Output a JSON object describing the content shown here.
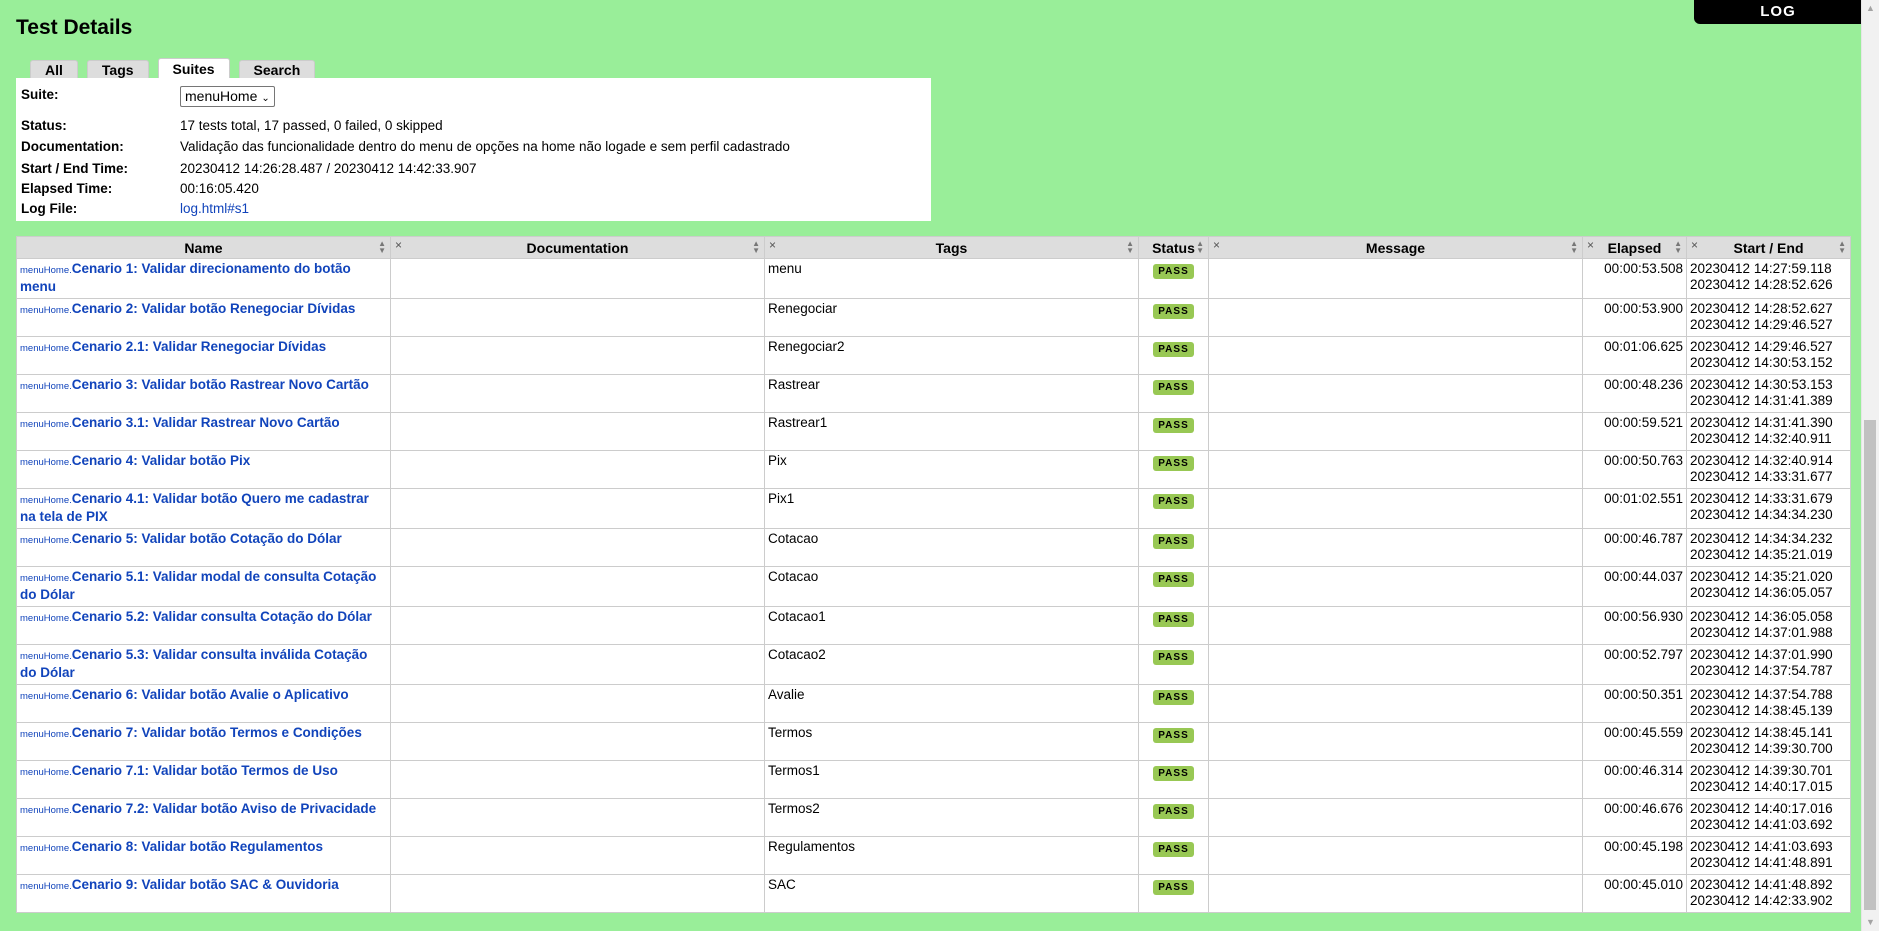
{
  "log_link": "LOG",
  "title": "Test Details",
  "tabs": [
    "All",
    "Tags",
    "Suites",
    "Search"
  ],
  "details": {
    "suite_label": "Suite:",
    "suite_value": "menuHome",
    "status_label": "Status:",
    "status_value": "17 tests total, 17 passed, 0 failed, 0 skipped",
    "doc_label": "Documentation:",
    "doc_value": "Validação das funcionalidade dentro do menu de opções na home não logade e sem perfil cadastrado",
    "time_label": "Start / End Time:",
    "time_value": "20230412 14:26:28.487 / 20230412 14:42:33.907",
    "elapsed_label": "Elapsed Time:",
    "elapsed_value": "00:16:05.420",
    "logfile_label": "Log File:",
    "logfile_value": "log.html#s1"
  },
  "table": {
    "headers": [
      "Name",
      "Documentation",
      "Tags",
      "Status",
      "Message",
      "Elapsed",
      "Start / End"
    ],
    "prefix": "menuHome.",
    "rows": [
      {
        "name": "Cenario 1: Validar direcionamento do botão menu",
        "tags": "menu",
        "status": "PASS",
        "elapsed": "00:00:53.508",
        "start": "20230412 14:27:59.118",
        "end": "20230412 14:28:52.626"
      },
      {
        "name": "Cenario 2: Validar botão Renegociar Dívidas",
        "tags": "Renegociar",
        "status": "PASS",
        "elapsed": "00:00:53.900",
        "start": "20230412 14:28:52.627",
        "end": "20230412 14:29:46.527"
      },
      {
        "name": "Cenario 2.1: Validar Renegociar Dívidas",
        "tags": "Renegociar2",
        "status": "PASS",
        "elapsed": "00:01:06.625",
        "start": "20230412 14:29:46.527",
        "end": "20230412 14:30:53.152"
      },
      {
        "name": "Cenario 3: Validar botão Rastrear Novo Cartão",
        "tags": "Rastrear",
        "status": "PASS",
        "elapsed": "00:00:48.236",
        "start": "20230412 14:30:53.153",
        "end": "20230412 14:31:41.389"
      },
      {
        "name": "Cenario 3.1: Validar Rastrear Novo Cartão",
        "tags": "Rastrear1",
        "status": "PASS",
        "elapsed": "00:00:59.521",
        "start": "20230412 14:31:41.390",
        "end": "20230412 14:32:40.911"
      },
      {
        "name": "Cenario 4: Validar botão Pix",
        "tags": "Pix",
        "status": "PASS",
        "elapsed": "00:00:50.763",
        "start": "20230412 14:32:40.914",
        "end": "20230412 14:33:31.677"
      },
      {
        "name": "Cenario 4.1: Validar botão Quero me cadastrar na tela de PIX",
        "tags": "Pix1",
        "status": "PASS",
        "elapsed": "00:01:02.551",
        "start": "20230412 14:33:31.679",
        "end": "20230412 14:34:34.230"
      },
      {
        "name": "Cenario 5: Validar botão Cotação do Dólar",
        "tags": "Cotacao",
        "status": "PASS",
        "elapsed": "00:00:46.787",
        "start": "20230412 14:34:34.232",
        "end": "20230412 14:35:21.019"
      },
      {
        "name": "Cenario 5.1: Validar modal de consulta Cotação do Dólar",
        "tags": "Cotacao",
        "status": "PASS",
        "elapsed": "00:00:44.037",
        "start": "20230412 14:35:21.020",
        "end": "20230412 14:36:05.057"
      },
      {
        "name": "Cenario 5.2: Validar consulta Cotação do Dólar",
        "tags": "Cotacao1",
        "status": "PASS",
        "elapsed": "00:00:56.930",
        "start": "20230412 14:36:05.058",
        "end": "20230412 14:37:01.988"
      },
      {
        "name": "Cenario 5.3: Validar consulta inválida Cotação do Dólar",
        "tags": "Cotacao2",
        "status": "PASS",
        "elapsed": "00:00:52.797",
        "start": "20230412 14:37:01.990",
        "end": "20230412 14:37:54.787"
      },
      {
        "name": "Cenario 6: Validar botão Avalie o Aplicativo",
        "tags": "Avalie",
        "status": "PASS",
        "elapsed": "00:00:50.351",
        "start": "20230412 14:37:54.788",
        "end": "20230412 14:38:45.139"
      },
      {
        "name": "Cenario 7: Validar botão Termos e Condições",
        "tags": "Termos",
        "status": "PASS",
        "elapsed": "00:00:45.559",
        "start": "20230412 14:38:45.141",
        "end": "20230412 14:39:30.700"
      },
      {
        "name": "Cenario 7.1: Validar botão Termos de Uso",
        "tags": "Termos1",
        "status": "PASS",
        "elapsed": "00:00:46.314",
        "start": "20230412 14:39:30.701",
        "end": "20230412 14:40:17.015"
      },
      {
        "name": "Cenario 7.2: Validar botão Aviso de Privacidade",
        "tags": "Termos2",
        "status": "PASS",
        "elapsed": "00:00:46.676",
        "start": "20230412 14:40:17.016",
        "end": "20230412 14:41:03.692"
      },
      {
        "name": "Cenario 8: Validar botão Regulamentos",
        "tags": "Regulamentos",
        "status": "PASS",
        "elapsed": "00:00:45.198",
        "start": "20230412 14:41:03.693",
        "end": "20230412 14:41:48.891"
      },
      {
        "name": "Cenario 9: Validar botão SAC & Ouvidoria",
        "tags": "SAC",
        "status": "PASS",
        "elapsed": "00:00:45.010",
        "start": "20230412 14:41:48.892",
        "end": "20230412 14:42:33.902"
      }
    ]
  },
  "colors": {
    "background": "#99ee99",
    "pass": "#98c854",
    "link": "#1144bb",
    "header": "#dddddd"
  }
}
